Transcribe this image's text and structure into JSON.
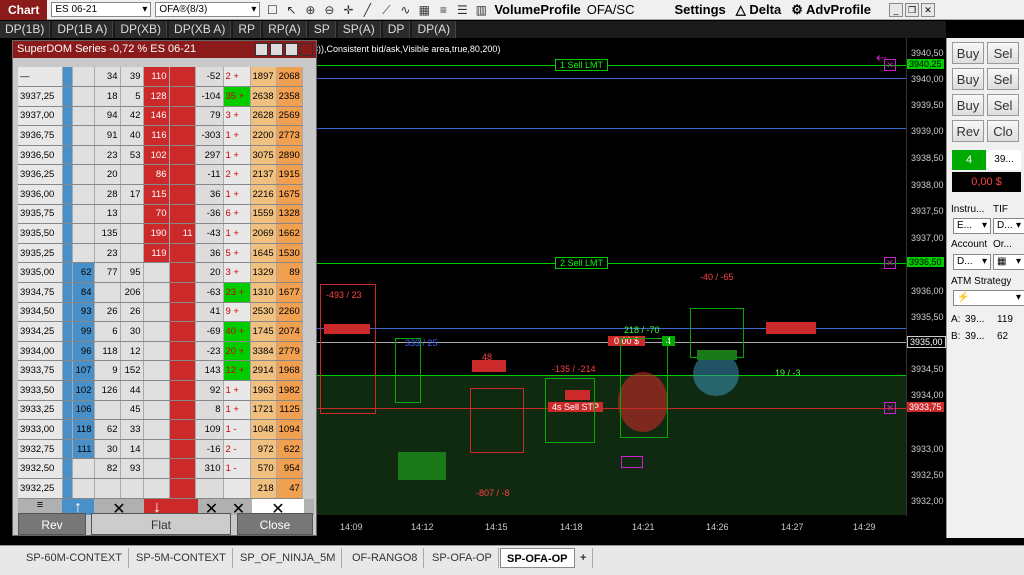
{
  "toolbar": {
    "chart_tab": "Chart",
    "instrument": "ES 06-21",
    "template": "OFA®(8/3)",
    "volume_profile": "VolumeProfile",
    "ofa_sc": "OFA/SC",
    "settings": "Settings",
    "delta": "Delta",
    "adv_profile": "AdvProfile"
  },
  "dp_tabs": [
    "DP(1B)",
    "DP(1B A)",
    "DP(XB)",
    "DP(XB A)",
    "RP",
    "RP(A)",
    "SP",
    "SP(A)",
    "DP",
    "DP(A)"
  ],
  "chart": {
    "indicator_text": "3)),Consistent bid/ask,Visible area,true,80,200)",
    "order_sell_lmt_1": "1  Sell LMT",
    "order_sell_lmt_2": "2  Sell LMT",
    "order_sell_stp": "4s  Sell STP",
    "pnl_box": "0.00 $",
    "pnl_qty": "4",
    "price_marker_3940": "3940,25",
    "price_marker_3936": "3936,50",
    "price_marker_3935": "3935,00",
    "price_marker_3933": "3933,75",
    "prices": [
      "3940,50",
      "3940,00",
      "3939,50",
      "3939,00",
      "3938,50",
      "3938,00",
      "3937,50",
      "3937,00",
      "3936,50",
      "3936,00",
      "3935,50",
      "3935,00",
      "3934,50",
      "3934,00",
      "3933,50",
      "3933,00",
      "3932,50",
      "3932,00"
    ],
    "times": [
      "14:09",
      "14:12",
      "14:15",
      "14:18",
      "14:21",
      "14:26",
      "14:27",
      "14:29"
    ],
    "deltas": [
      "-493 / 23",
      "333 / 25",
      "48",
      "-135 / -214",
      "218 / -70",
      "-40 / -65",
      "19 / -3",
      "-807 / -8"
    ]
  },
  "superdom": {
    "title": "SuperDOM Series -0,72 % ES 06-21",
    "rows": [
      [
        "—",
        "",
        "34",
        "39",
        "110",
        "",
        "-52",
        "2 +",
        "1897",
        "2068"
      ],
      [
        "3937,25",
        "",
        "18",
        "5",
        "128",
        "",
        "-104",
        "35 +",
        "2638",
        "2358"
      ],
      [
        "3937,00",
        "",
        "94",
        "42",
        "146",
        "",
        "79",
        "3 +",
        "2628",
        "2569"
      ],
      [
        "3936,75",
        "",
        "91",
        "40",
        "116",
        "",
        "-303",
        "1 +",
        "2200",
        "2773"
      ],
      [
        "3936,50",
        "",
        "23",
        "53",
        "102",
        "",
        "297",
        "1 +",
        "3075",
        "2890"
      ],
      [
        "3936,25",
        "",
        "20",
        "",
        "86",
        "",
        "-11",
        "2 +",
        "2137",
        "1915"
      ],
      [
        "3936,00",
        "",
        "28",
        "17",
        "115",
        "",
        "36",
        "1 +",
        "2216",
        "1675"
      ],
      [
        "3935,75",
        "",
        "13",
        "",
        "70",
        "",
        "-36",
        "6 +",
        "1559",
        "1328"
      ],
      [
        "3935,50",
        "",
        "135",
        "",
        "190",
        "11",
        "-43",
        "1 +",
        "2069",
        "1662"
      ],
      [
        "3935,25",
        "",
        "23",
        "",
        "119",
        "",
        "36",
        "5 +",
        "1645",
        "1530"
      ],
      [
        "3935,00",
        "62",
        "77",
        "95",
        "",
        "",
        "20",
        "3 +",
        "1329",
        "89"
      ],
      [
        "3934,75",
        "84",
        "",
        "206",
        "",
        "",
        "-63",
        "23 +",
        "1310",
        "1677"
      ],
      [
        "3934,50",
        "93",
        "26",
        "26",
        "",
        "",
        "41",
        "9 +",
        "2530",
        "2260"
      ],
      [
        "3934,25",
        "99",
        "6",
        "30",
        "",
        "",
        "-69",
        "40 +",
        "1745",
        "2074"
      ],
      [
        "3934,00",
        "96",
        "118",
        "12",
        "",
        "",
        "-23",
        "20 +",
        "3384",
        "2779"
      ],
      [
        "3933,75",
        "107",
        "9",
        "152",
        "",
        "",
        "143",
        "12 +",
        "2914",
        "1968"
      ],
      [
        "3933,50",
        "102",
        "126",
        "44",
        "",
        "",
        "92",
        "1 +",
        "1963",
        "1982"
      ],
      [
        "3933,25",
        "106",
        "",
        "45",
        "",
        "",
        "8",
        "1 +",
        "1721",
        "1125"
      ],
      [
        "3933,00",
        "118",
        "62",
        "33",
        "",
        "",
        "109",
        "1 -",
        "1048",
        "1094"
      ],
      [
        "3932,75",
        "111",
        "30",
        "14",
        "",
        "",
        "-16",
        "2 -",
        "972",
        "622"
      ],
      [
        "3932,50",
        "",
        "82",
        "93",
        "",
        "",
        "310",
        "1 -",
        "570",
        "954"
      ],
      [
        "3932,25",
        "",
        "",
        "",
        "",
        "",
        "",
        "",
        "218",
        "47"
      ]
    ],
    "rev": "Rev",
    "flat": "Flat",
    "close": "Close"
  },
  "right_panel": {
    "buy": "Buy",
    "sell": "Sel",
    "rev": "Rev",
    "close": "Clo",
    "qty": "4",
    "qty_price": "39...",
    "pnl": "0,00 $",
    "instrument_label": "Instru...",
    "tif_label": "TIF",
    "instrument_val": "E...",
    "tif_val": "D...",
    "account_label": "Account",
    "order_label": "Or...",
    "account_val": "D...",
    "atm_label": "ATM Strategy",
    "ask_label": "A:",
    "ask_price": "39...",
    "ask_size": "119",
    "bid_label": "B:",
    "bid_price": "39...",
    "bid_size": "62"
  },
  "bottom_tabs": [
    "SP-60M-CONTEXT",
    "SP-5M-CONTEXT",
    "SP_OF_NINJA_5M",
    "OF-RANGO8",
    "SP-OFA-OP",
    "SP-OFA-OP",
    "+"
  ],
  "colors": {
    "accent": "#8b1a1a",
    "buy_green": "#00cc00",
    "sell_red": "#cc2a2a",
    "bid_blue": "#4a90c8"
  }
}
